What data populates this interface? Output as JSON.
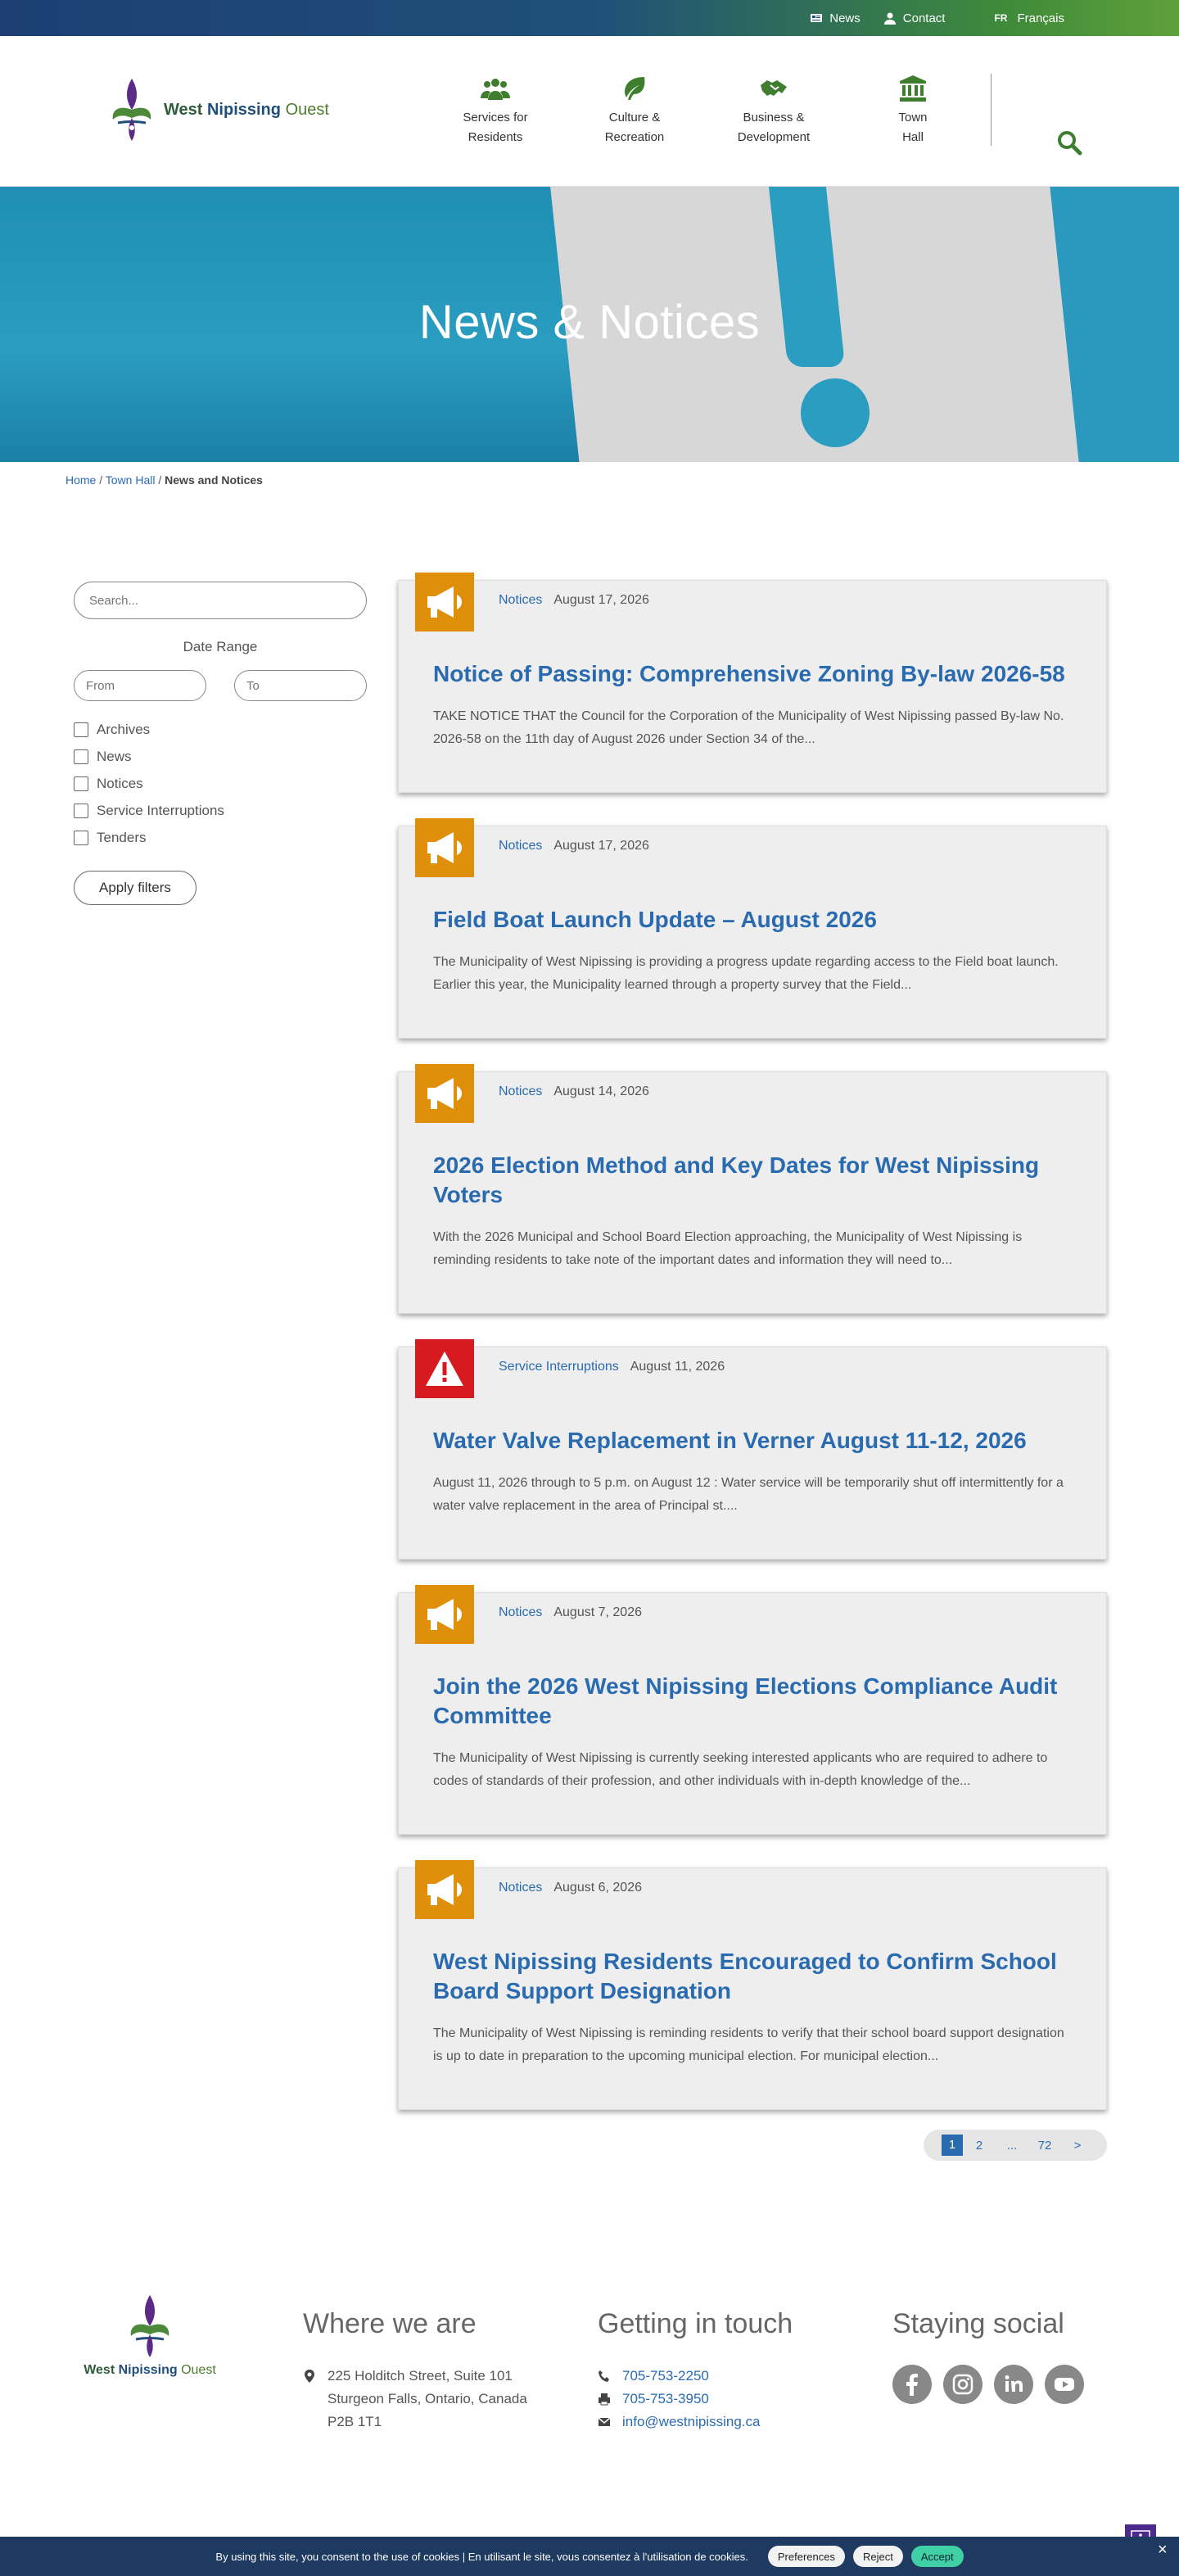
{
  "topbar": {
    "news": "News",
    "contact": "Contact",
    "lang_code": "FR",
    "lang_label": "Français"
  },
  "header": {
    "logo_west": "West",
    "logo_nipissing": "Nipissing",
    "logo_ouest": "Ouest",
    "nav": [
      {
        "line1": "Services for",
        "line2": "Residents",
        "icon": "people-icon"
      },
      {
        "line1": "Culture &",
        "line2": "Recreation",
        "icon": "leaf-icon"
      },
      {
        "line1": "Business &",
        "line2": "Development",
        "icon": "handshake-icon"
      },
      {
        "line1": "Town",
        "line2": "Hall",
        "icon": "building-icon"
      }
    ]
  },
  "hero": {
    "title": "News & Notices"
  },
  "breadcrumb": {
    "home": "Home",
    "sep": " / ",
    "townhall": "Town Hall",
    "current": "News and Notices"
  },
  "sidebar": {
    "search_placeholder": "Search...",
    "date_range": "Date Range",
    "from_placeholder": "From",
    "to_placeholder": "To",
    "filters": [
      "Archives",
      "News",
      "Notices",
      "Service Interruptions",
      "Tenders"
    ],
    "apply": "Apply filters"
  },
  "articles": [
    {
      "category": "Notices",
      "date": "August 17, 2026",
      "title": "Notice of Passing: Comprehensive Zoning By-law 2026-58",
      "excerpt": "TAKE NOTICE THAT the Council for the Corporation of the Municipality of West Nipissing passed By-law No. 2026-58 on the 11th day of August 2026 under Section 34 of the...",
      "icon": "megaphone-icon"
    },
    {
      "category": "Notices",
      "date": "August 17, 2026",
      "title": "Field Boat Launch Update – August 2026",
      "excerpt": "The Municipality of West Nipissing is providing a progress update regarding access to the Field boat launch. Earlier this year, the Municipality learned through a property survey that the Field...",
      "icon": "megaphone-icon"
    },
    {
      "category": "Notices",
      "date": "August 14, 2026",
      "title": "2026 Election Method and Key Dates for West Nipissing Voters",
      "excerpt": "With the 2026 Municipal and School Board Election approaching, the Municipality of West Nipissing is reminding residents to take note of the important dates and information they will need to...",
      "icon": "megaphone-icon"
    },
    {
      "category": "Service Interruptions",
      "date": "August 11, 2026",
      "title": "Water Valve Replacement in Verner August 11-12, 2026",
      "excerpt": "August 11, 2026 through to 5 p.m. on August 12 : Water service will be temporarily shut off intermittently for a water valve replacement in the area of Principal st....",
      "icon": "warning-icon"
    },
    {
      "category": "Notices",
      "date": "August 7, 2026",
      "title": "Join the 2026 West Nipissing Elections Compliance Audit Committee",
      "excerpt": "The Municipality of West Nipissing is currently seeking interested applicants who are required to adhere to codes of standards of their profession, and other individuals with in-depth knowledge of the...",
      "icon": "megaphone-icon"
    },
    {
      "category": "Notices",
      "date": "August 6, 2026",
      "title": "West Nipissing Residents Encouraged to Confirm School Board Support Designation",
      "excerpt": "The Municipality of West Nipissing is reminding residents to verify that their school board support designation is up to date in preparation to the upcoming municipal election. For municipal election...",
      "icon": "megaphone-icon"
    }
  ],
  "pager": {
    "current": "1",
    "next_page": "2",
    "ellipsis": "...",
    "last": "72",
    "next": ">"
  },
  "footer": {
    "where_title": "Where we are",
    "address1": "225 Holditch Street, Suite 101",
    "address2": "Sturgeon Falls, Ontario, Canada",
    "address3": "P2B 1T1",
    "touch_title": "Getting in touch",
    "phone": "705-753-2250",
    "fax": "705-753-3950",
    "email": "info@westnipissing.ca",
    "social_title": "Staying social"
  },
  "cookie": {
    "text": "By using this site, you consent to the use of cookies  |  En utilisant le site, vous consentez à l'utilisation de cookies.",
    "preferences": "Preferences",
    "reject": "Reject",
    "accept": "Accept",
    "close": "×"
  },
  "colors": {
    "brand_blue": "#2a6bb0",
    "notice_orange": "#e08f0a",
    "alert_red": "#d71920",
    "green": "#3f7e2e"
  }
}
